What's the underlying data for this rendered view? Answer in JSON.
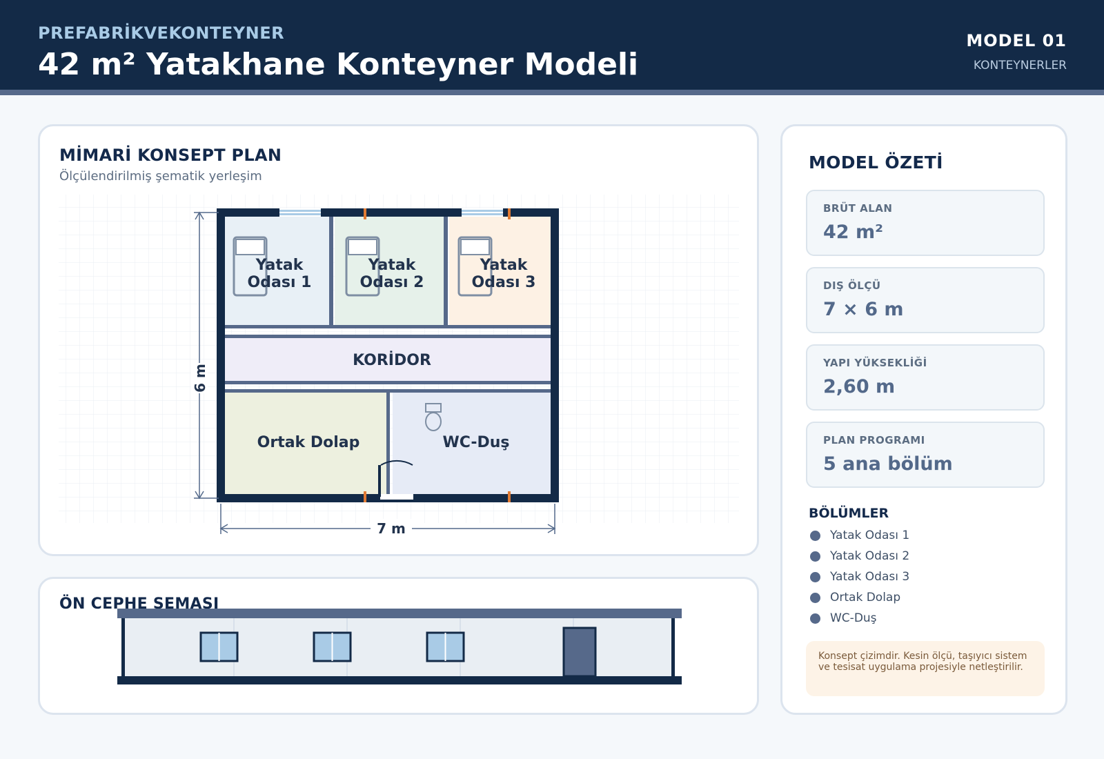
{
  "header": {
    "brand": "PREFABRİKVEKONTEYNER",
    "title": "42 m² Yatakhane Konteyner Modeli",
    "model_code": "MODEL 01",
    "category": "KONTEYNERLER"
  },
  "plan": {
    "title": "MİMARİ KONSEPT PLAN",
    "subtitle": "Ölçülendirilmiş şematik yerleşim",
    "rooms": {
      "bed1_l1": "Yatak",
      "bed1_l2": "Odası 1",
      "bed2_l1": "Yatak",
      "bed2_l2": "Odası 2",
      "bed3_l1": "Yatak",
      "bed3_l2": "Odası 3",
      "corridor": "KORİDOR",
      "storage": "Ortak Dolap",
      "wc": "WC-Duş"
    },
    "dim_height": "6 m",
    "dim_width": "7 m"
  },
  "facade": {
    "title": "ÖN CEPHE ŞEMASI"
  },
  "summary": {
    "title": "MODEL ÖZETİ",
    "stats": [
      {
        "label": "BRÜT ALAN",
        "value": "42 m²"
      },
      {
        "label": "DIŞ ÖLÇÜ",
        "value": "7 × 6 m"
      },
      {
        "label": "YAPI YÜKSEKLİĞİ",
        "value": "2,60 m"
      },
      {
        "label": "PLAN PROGRAMI",
        "value": "5 ana bölüm"
      }
    ],
    "sections_title": "BÖLÜMLER",
    "sections": [
      "Yatak Odası 1",
      "Yatak Odası 2",
      "Yatak Odası 3",
      "Ortak Dolap",
      "WC-Duş"
    ],
    "note": "Konsept çizimdir. Kesin ölçü, taşıyıcı sistem ve tesisat uygulama projesiyle netleştirilir."
  },
  "colors": {
    "navy": "#132a47",
    "slate": "#56698a",
    "bed1": "#e8f0f6",
    "bed2": "#e6f1ea",
    "bed3": "#fdf1e4",
    "corridor": "#efedf8",
    "storage": "#edf0df",
    "wc": "#e6ebf6",
    "window": "#a9cbe6",
    "accent": "#e07a33"
  }
}
